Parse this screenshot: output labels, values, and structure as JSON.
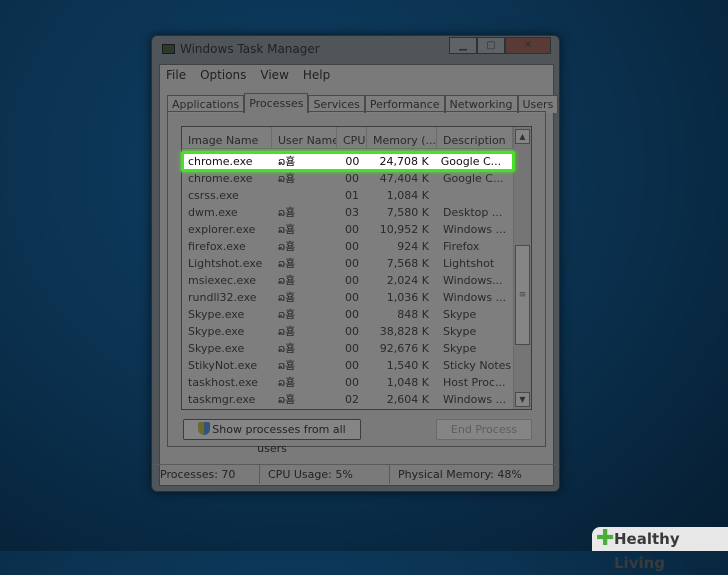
{
  "window": {
    "title": "Windows Task Manager",
    "controls": [
      "minimize",
      "maximize",
      "close"
    ]
  },
  "menu": [
    "File",
    "Options",
    "View",
    "Help"
  ],
  "tabs": [
    {
      "label": "Applications"
    },
    {
      "label": "Processes",
      "active": true
    },
    {
      "label": "Services"
    },
    {
      "label": "Performance"
    },
    {
      "label": "Networking"
    },
    {
      "label": "Users"
    }
  ],
  "columns": [
    "Image Name",
    "User Name",
    "CPU",
    "Memory (...",
    "Description"
  ],
  "highlight": {
    "name": "chrome.exe",
    "user": "ລ횸",
    "cpu": "00",
    "mem": "24,708 K",
    "desc": "Google C...",
    "color": "#4ae02a"
  },
  "rows": [
    {
      "name": "chrome.exe",
      "user": "ລ횸",
      "cpu": "00",
      "mem": "47,404 K",
      "desc": "Google C..."
    },
    {
      "name": "csrss.exe",
      "user": "",
      "cpu": "01",
      "mem": "1,084 K",
      "desc": ""
    },
    {
      "name": "dwm.exe",
      "user": "ລ횸",
      "cpu": "03",
      "mem": "7,580 K",
      "desc": "Desktop ..."
    },
    {
      "name": "explorer.exe",
      "user": "ລ횸",
      "cpu": "00",
      "mem": "10,952 K",
      "desc": "Windows ..."
    },
    {
      "name": "firefox.exe",
      "user": "ລ횸",
      "cpu": "00",
      "mem": "924 K",
      "desc": "Firefox"
    },
    {
      "name": "Lightshot.exe",
      "user": "ລ횸",
      "cpu": "00",
      "mem": "7,568 K",
      "desc": "Lightshot"
    },
    {
      "name": "msiexec.exe",
      "user": "ລ횸",
      "cpu": "00",
      "mem": "2,024 K",
      "desc": "Windows..."
    },
    {
      "name": "rundll32.exe",
      "user": "ລ횸",
      "cpu": "00",
      "mem": "1,036 K",
      "desc": "Windows ..."
    },
    {
      "name": "Skype.exe",
      "user": "ລ횸",
      "cpu": "00",
      "mem": "848 K",
      "desc": "Skype"
    },
    {
      "name": "Skype.exe",
      "user": "ລ횸",
      "cpu": "00",
      "mem": "38,828 K",
      "desc": "Skype"
    },
    {
      "name": "Skype.exe",
      "user": "ລ횸",
      "cpu": "00",
      "mem": "92,676 K",
      "desc": "Skype"
    },
    {
      "name": "StikyNot.exe",
      "user": "ລ횸",
      "cpu": "00",
      "mem": "1,540 K",
      "desc": "Sticky Notes"
    },
    {
      "name": "taskhost.exe",
      "user": "ລ횸",
      "cpu": "00",
      "mem": "1,048 K",
      "desc": "Host Proc..."
    },
    {
      "name": "taskmgr.exe",
      "user": "ລ횸",
      "cpu": "02",
      "mem": "2,604 K",
      "desc": "Windows ..."
    }
  ],
  "buttons": {
    "show_all": "Show processes from all users",
    "end": "End Process"
  },
  "status": {
    "processes": "Processes: 70",
    "cpu": "CPU Usage: 5%",
    "memory": "Physical Memory: 48%"
  },
  "watermark": "Healthy Living"
}
